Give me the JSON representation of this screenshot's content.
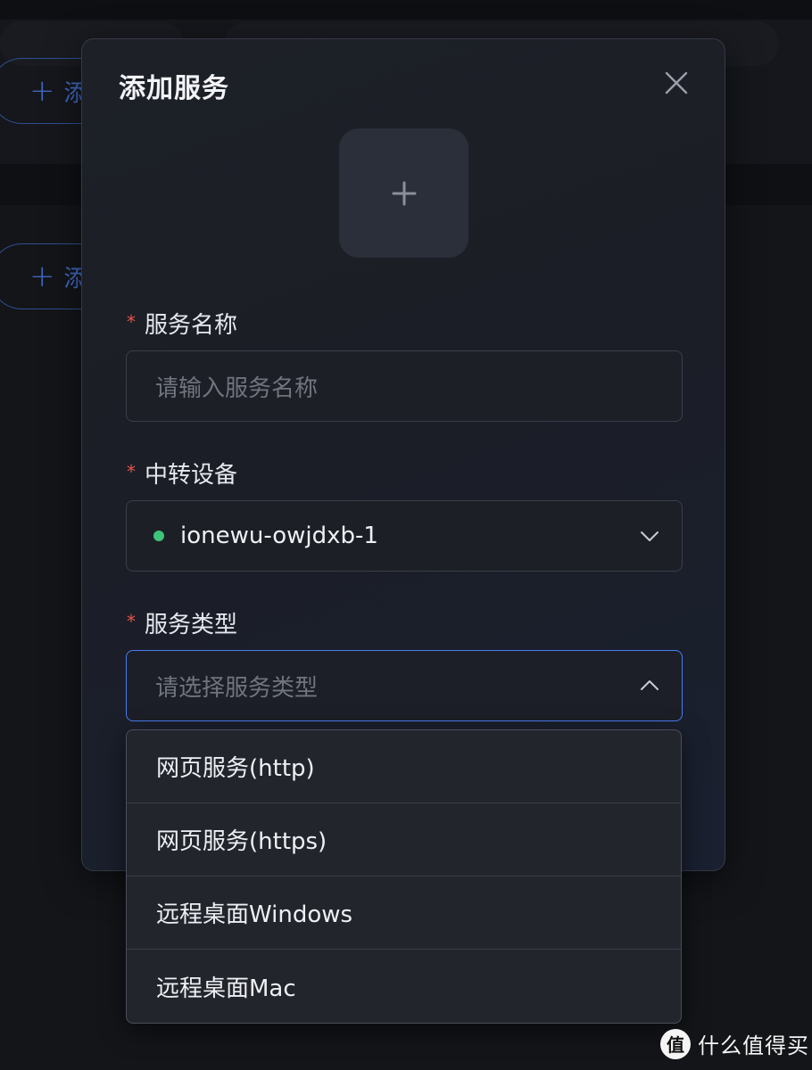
{
  "background": {
    "add_button_label": "添"
  },
  "modal": {
    "title": "添加服务",
    "fields": {
      "name": {
        "required_mark": "*",
        "label": "服务名称",
        "placeholder": "请输入服务名称"
      },
      "device": {
        "required_mark": "*",
        "label": "中转设备",
        "value": "ionewu-owjdxb-1",
        "status_color": "#3ec47a"
      },
      "type": {
        "required_mark": "*",
        "label": "服务类型",
        "placeholder": "请选择服务类型"
      }
    },
    "dropdown": {
      "options": [
        "网页服务(http)",
        "网页服务(https)",
        "远程桌面Windows",
        "远程桌面Mac"
      ]
    }
  },
  "watermark": {
    "logo_char": "值",
    "text": "什么值得买"
  },
  "colors": {
    "accent": "#4b7cf3",
    "required": "#e5534b",
    "online": "#3ec47a"
  }
}
